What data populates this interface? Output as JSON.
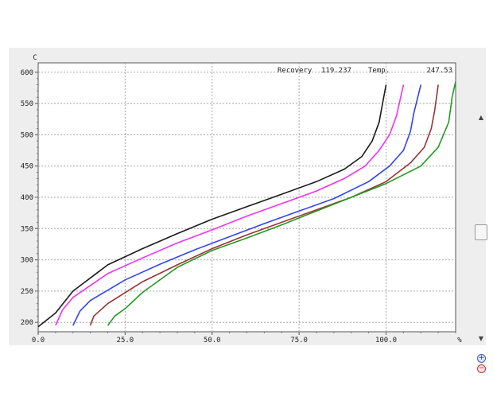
{
  "header": {
    "recovery_label": "Recovery",
    "recovery_value": "119.237",
    "temp_label": "Temp.",
    "temp_value": "247.53"
  },
  "chart_data": {
    "type": "line",
    "xlabel": "%",
    "ylabel": "C",
    "xlim": [
      0,
      120
    ],
    "ylim": [
      185,
      615
    ],
    "x_ticks": [
      "0.0",
      "25.0",
      "50.0",
      "75.0",
      "100.0"
    ],
    "y_ticks": [
      "200",
      "250",
      "300",
      "350",
      "400",
      "450",
      "500",
      "550",
      "600"
    ],
    "grid": true,
    "series": [
      {
        "color": "#1a1a1a",
        "points": [
          [
            0,
            193
          ],
          [
            5,
            215
          ],
          [
            10,
            250
          ],
          [
            20,
            292
          ],
          [
            30,
            318
          ],
          [
            40,
            342
          ],
          [
            50,
            365
          ],
          [
            60,
            385
          ],
          [
            70,
            405
          ],
          [
            80,
            425
          ],
          [
            88,
            445
          ],
          [
            93,
            465
          ],
          [
            96,
            490
          ],
          [
            98,
            520
          ],
          [
            99,
            550
          ],
          [
            100,
            580
          ]
        ]
      },
      {
        "color": "#ee33ee",
        "points": [
          [
            5,
            195
          ],
          [
            7,
            220
          ],
          [
            10,
            240
          ],
          [
            20,
            278
          ],
          [
            30,
            303
          ],
          [
            40,
            327
          ],
          [
            50,
            348
          ],
          [
            60,
            370
          ],
          [
            70,
            390
          ],
          [
            80,
            410
          ],
          [
            88,
            430
          ],
          [
            94,
            450
          ],
          [
            98,
            475
          ],
          [
            101,
            500
          ],
          [
            103,
            530
          ],
          [
            104,
            555
          ],
          [
            105,
            580
          ]
        ]
      },
      {
        "color": "#3344ee",
        "points": [
          [
            10,
            195
          ],
          [
            12,
            218
          ],
          [
            15,
            235
          ],
          [
            25,
            268
          ],
          [
            35,
            293
          ],
          [
            45,
            316
          ],
          [
            55,
            337
          ],
          [
            65,
            358
          ],
          [
            75,
            378
          ],
          [
            85,
            398
          ],
          [
            95,
            425
          ],
          [
            101,
            450
          ],
          [
            105,
            475
          ],
          [
            107,
            505
          ],
          [
            108,
            535
          ],
          [
            110,
            580
          ]
        ]
      },
      {
        "color": "#993333",
        "points": [
          [
            15,
            195
          ],
          [
            16,
            210
          ],
          [
            20,
            230
          ],
          [
            30,
            265
          ],
          [
            40,
            292
          ],
          [
            50,
            318
          ],
          [
            60,
            340
          ],
          [
            70,
            360
          ],
          [
            80,
            380
          ],
          [
            90,
            400
          ],
          [
            100,
            425
          ],
          [
            107,
            455
          ],
          [
            111,
            480
          ],
          [
            113,
            510
          ],
          [
            114,
            540
          ],
          [
            115,
            580
          ]
        ]
      },
      {
        "color": "#229922",
        "points": [
          [
            20,
            195
          ],
          [
            22,
            210
          ],
          [
            25,
            222
          ],
          [
            30,
            248
          ],
          [
            40,
            288
          ],
          [
            50,
            315
          ],
          [
            60,
            335
          ],
          [
            70,
            356
          ],
          [
            80,
            378
          ],
          [
            90,
            400
          ],
          [
            100,
            422
          ],
          [
            110,
            450
          ],
          [
            115,
            480
          ],
          [
            118,
            520
          ],
          [
            119,
            560
          ],
          [
            120,
            585
          ]
        ]
      }
    ]
  },
  "icons": {
    "scroll_up": "arrow-up-icon",
    "scroll_down": "arrow-down-icon",
    "zoom_in": "zoom-in-icon",
    "zoom_out": "zoom-out-icon"
  }
}
